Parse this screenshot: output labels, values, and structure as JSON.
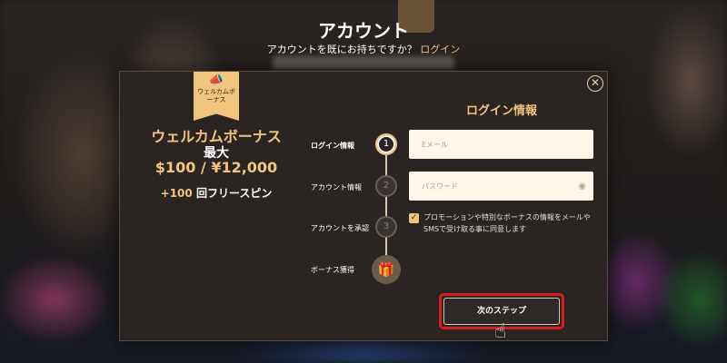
{
  "header": {
    "title": "アカウント",
    "subtitle_text": "アカウントを既にお持ちですか？",
    "login_link": "ログイン"
  },
  "modal": {
    "close_icon": "close-icon",
    "promo": {
      "tag_icon": "megaphone-icon",
      "tag_text": "ウェルカムボーナス",
      "title": "ウェルカムボーナス",
      "max_label": "最大",
      "amount": "$100 / ¥12,000",
      "spins_number": "+100",
      "spins_label": "回フリースピン"
    },
    "steps": [
      {
        "label": "ログイン情報",
        "number": "1",
        "active": true
      },
      {
        "label": "アカウント情報",
        "number": "2",
        "active": false
      },
      {
        "label": "アカウントを承認",
        "number": "3",
        "active": false
      },
      {
        "label": "ボーナス獲得",
        "icon": "gift-icon",
        "active": false
      }
    ],
    "form": {
      "title": "ログイン情報",
      "email_placeholder": "Eメール",
      "password_placeholder": "パスワード",
      "password_icon": "eye-icon",
      "consent_checked": true,
      "consent_text": "プロモーションや特別なボーナスの情報をメールやSMSで受け取る事に同意します",
      "next_button": "次のステップ"
    }
  },
  "colors": {
    "accent": "#f2c57c",
    "modal_bg": "#2a2523",
    "highlight": "#d71e1e"
  }
}
